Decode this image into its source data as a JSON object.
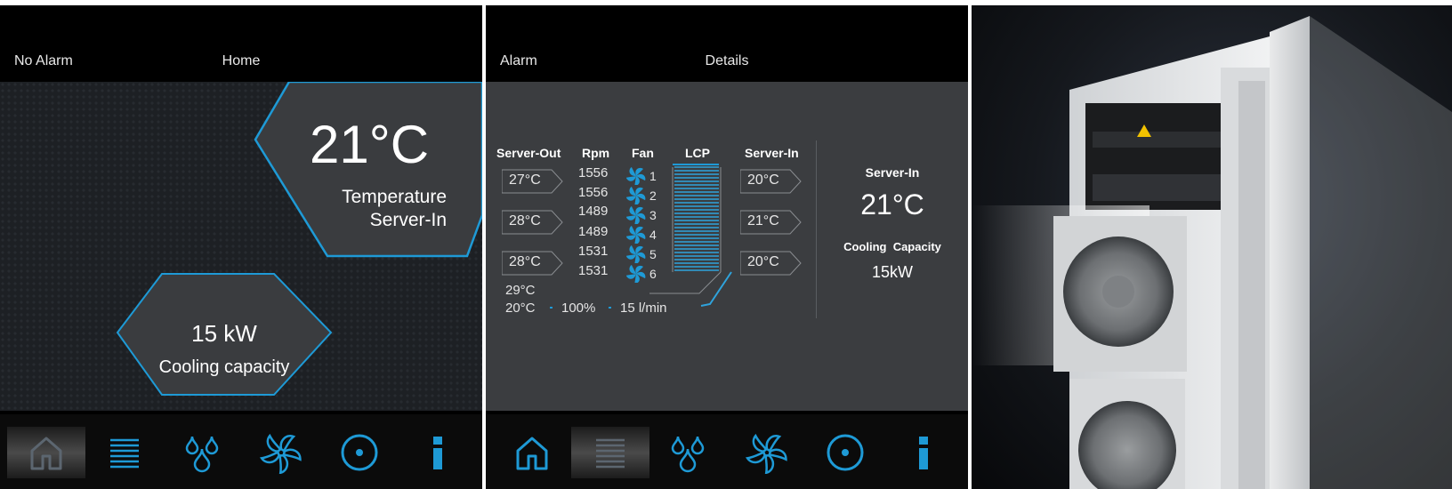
{
  "home": {
    "status": "No Alarm",
    "title": "Home",
    "temperature": "21°C",
    "temperature_label_line1": "Temperature",
    "temperature_label_line2": "Server-In",
    "power": "15 kW",
    "power_label": "Cooling capacity"
  },
  "details": {
    "status": "Alarm",
    "title": "Details",
    "headers": {
      "server_out": "Server-Out",
      "rpm": "Rpm",
      "fan": "Fan",
      "lcp": "LCP",
      "server_in": "Server-In"
    },
    "server_out_temps": [
      "27°C",
      "28°C",
      "28°C"
    ],
    "server_in_temps": [
      "20°C",
      "21°C",
      "20°C"
    ],
    "rpms": [
      "1556",
      "1556",
      "1489",
      "1489",
      "1531",
      "1531"
    ],
    "fans": [
      "1",
      "2",
      "3",
      "4",
      "5",
      "6"
    ],
    "water_out": "29°C",
    "water_in": "20°C",
    "valve": "100%",
    "flow": "15 l/min",
    "summary": {
      "title": "Server-In",
      "temperature": "21°C",
      "capacity_label": "Cooling  Capacity",
      "capacity": "15kW"
    }
  },
  "nav": {
    "items": [
      "home-icon",
      "list-icon",
      "water-drops-icon",
      "fan-icon",
      "circle-dot-icon",
      "info-icon"
    ]
  },
  "colors": {
    "accent": "#1e9ad6",
    "active_nav_bg": "#3a3a3a",
    "background_dark": "#000000"
  }
}
